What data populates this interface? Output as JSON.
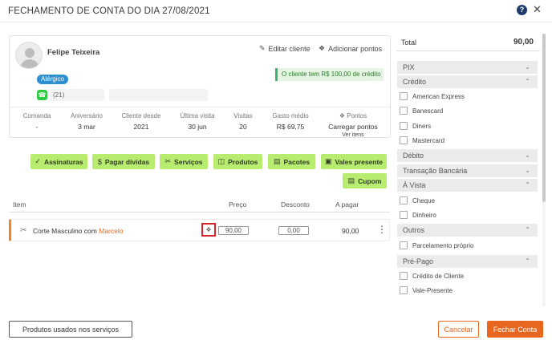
{
  "window": {
    "title": "FECHAMENTO DE CONTA DO DIA 27/08/2021",
    "help_glyph": "?",
    "close_glyph": "✕"
  },
  "client": {
    "name": "Felipe Teixeira",
    "edit_label": "Editar cliente",
    "add_points_label": "Adicionar pontos",
    "allergy_badge": "Alérgico",
    "credit_message": "O cliente tem R$ 100,00 de crédito",
    "phone": "(21)",
    "stats": [
      {
        "label": "Comanda",
        "value": "-"
      },
      {
        "label": "Aniversário",
        "value": "3 mar"
      },
      {
        "label": "Cliente desde",
        "value": "2021"
      },
      {
        "label": "Última visita",
        "value": "30 jun"
      },
      {
        "label": "Visitas",
        "value": "20"
      },
      {
        "label": "Gasto médio",
        "value": "R$ 69,75"
      },
      {
        "label": "Pontos",
        "value": "Carregar pontos",
        "sub": "Ver itens"
      }
    ]
  },
  "actions": {
    "assinaturas": "Assinaturas",
    "pagar_dividas": "Pagar dívidas",
    "servicos": "Serviços",
    "produtos": "Produtos",
    "pacotes": "Pacotes",
    "vales_presente": "Vales presente",
    "cupom": "Cupom"
  },
  "table": {
    "headers": {
      "item": "Item",
      "preco": "Preço",
      "desconto": "Desconto",
      "a_pagar": "A pagar"
    },
    "rows": [
      {
        "service": "Corte Masculino",
        "connector": "com",
        "professional": "Marcelo",
        "price": "90,00",
        "discount": "0,00",
        "total": "90,00"
      }
    ]
  },
  "footer": {
    "products_used_label": "Produtos usados nos serviços",
    "cancel_label": "Cancelar",
    "close_account_label": "Fechar Conta"
  },
  "payment": {
    "total_label": "Total",
    "total_value": "90,00",
    "groups": {
      "pix": "PIX",
      "credito": "Crédito",
      "debito": "Débito",
      "transacao": "Transação Bancária",
      "a_vista": "À Vista",
      "outros": "Outros",
      "pre_pago": "Pré-Pago"
    },
    "credito_options": [
      "American Express",
      "Banescard",
      "Diners",
      "Mastercard"
    ],
    "a_vista_options": [
      "Cheque",
      "Dinheiro"
    ],
    "outros_options": [
      "Parcelamento próprio"
    ],
    "pre_pago_options": [
      "Crédito de Cliente",
      "Vale-Presente"
    ]
  },
  "colors": {
    "action_green": "#b8ec6f",
    "accent_orange": "#e8661e",
    "allergy_blue": "#2c8fd1",
    "credit_green": "#3cb371"
  }
}
